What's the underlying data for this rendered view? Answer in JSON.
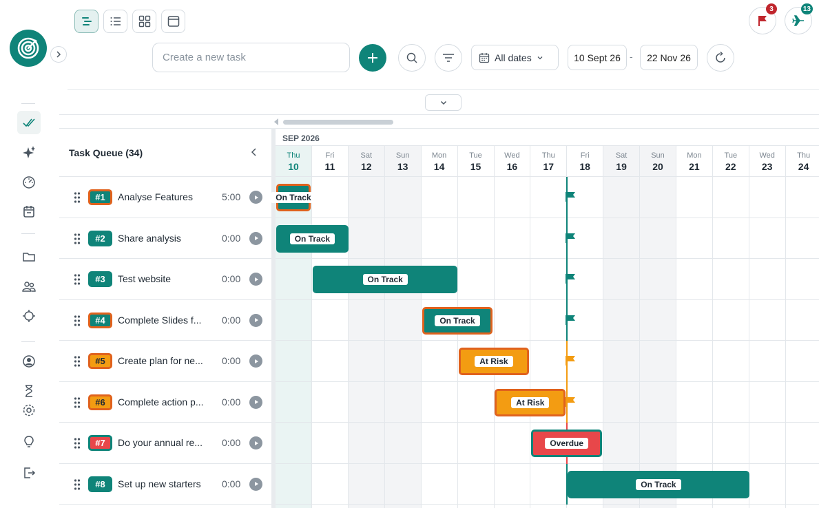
{
  "toolbar": {
    "views": [
      "timeline-view",
      "list-view",
      "grid-view",
      "window-view"
    ],
    "task_input_placeholder": "Create a new task",
    "dates_label": "All dates",
    "date_from": "10 Sept 26",
    "date_separator": "-",
    "date_to": "22 Nov 26",
    "flags_badge": "3",
    "planes_badge": "13"
  },
  "colors": {
    "teal": "#0f8479",
    "amber": "#f39c12",
    "red": "#e8474a",
    "orange_outline": "#e0621d"
  },
  "queue": {
    "title": "Task Queue (34)",
    "tasks": [
      {
        "id": "#1",
        "name": "Analyse Features",
        "time": "5:00",
        "style": "teal-o"
      },
      {
        "id": "#2",
        "name": "Share analysis",
        "time": "0:00",
        "style": "teal"
      },
      {
        "id": "#3",
        "name": "Test website",
        "time": "0:00",
        "style": "teal"
      },
      {
        "id": "#4",
        "name": "Complete Slides f...",
        "time": "0:00",
        "style": "teal-o"
      },
      {
        "id": "#5",
        "name": "Create plan for ne...",
        "time": "0:00",
        "style": "amber-o"
      },
      {
        "id": "#6",
        "name": "Complete action p...",
        "time": "0:00",
        "style": "amber-o"
      },
      {
        "id": "#7",
        "name": "Do your annual re...",
        "time": "0:00",
        "style": "red-o"
      },
      {
        "id": "#8",
        "name": "Set up new starters",
        "time": "0:00",
        "style": "teal"
      }
    ]
  },
  "gantt": {
    "month": "SEP 2026",
    "days": [
      {
        "name": "Thu",
        "num": "10",
        "kind": "today"
      },
      {
        "name": "Fri",
        "num": "11",
        "kind": ""
      },
      {
        "name": "Sat",
        "num": "12",
        "kind": "weekend"
      },
      {
        "name": "Sun",
        "num": "13",
        "kind": "weekend"
      },
      {
        "name": "Mon",
        "num": "14",
        "kind": ""
      },
      {
        "name": "Tue",
        "num": "15",
        "kind": ""
      },
      {
        "name": "Wed",
        "num": "16",
        "kind": ""
      },
      {
        "name": "Thu",
        "num": "17",
        "kind": ""
      },
      {
        "name": "Fri",
        "num": "18",
        "kind": ""
      },
      {
        "name": "Sat",
        "num": "19",
        "kind": "weekend"
      },
      {
        "name": "Sun",
        "num": "20",
        "kind": "weekend"
      },
      {
        "name": "Mon",
        "num": "21",
        "kind": ""
      },
      {
        "name": "Tue",
        "num": "22",
        "kind": ""
      },
      {
        "name": "Wed",
        "num": "23",
        "kind": ""
      },
      {
        "name": "Thu",
        "num": "24",
        "kind": ""
      }
    ],
    "bars": [
      {
        "task": "#1",
        "status": "On Track",
        "style": "teal-o",
        "start_day": "10",
        "end_day": "10"
      },
      {
        "task": "#2",
        "status": "On Track",
        "style": "teal",
        "start_day": "10",
        "end_day": "11"
      },
      {
        "task": "#3",
        "status": "On Track",
        "style": "teal",
        "start_day": "11",
        "end_day": "14"
      },
      {
        "task": "#4",
        "status": "On Track",
        "style": "teal-o",
        "start_day": "14",
        "end_day": "15"
      },
      {
        "task": "#5",
        "status": "At Risk",
        "style": "amber-o",
        "start_day": "15",
        "end_day": "16"
      },
      {
        "task": "#6",
        "status": "At Risk",
        "style": "amber-o",
        "start_day": "16",
        "end_day": "17"
      },
      {
        "task": "#7",
        "status": "Overdue",
        "style": "red-o",
        "start_day": "17",
        "end_day": "18"
      },
      {
        "task": "#8",
        "status": "On Track",
        "style": "teal",
        "start_day": "18",
        "end_day": "22"
      }
    ]
  }
}
